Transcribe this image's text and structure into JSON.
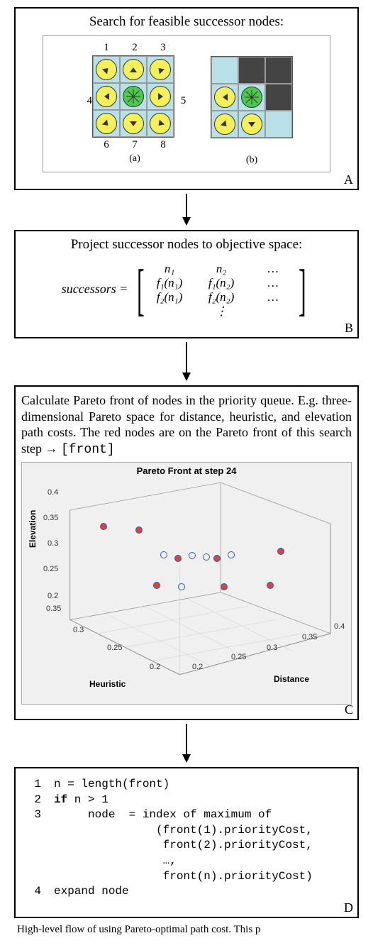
{
  "boxA": {
    "title": "Search for feasible successor nodes:",
    "label": "A",
    "gridA": {
      "top_labels": [
        "1",
        "2",
        "3"
      ],
      "left_label": "4",
      "right_label": "5",
      "bottom_labels": [
        "6",
        "7",
        "8"
      ],
      "sub": "(a)"
    },
    "gridB": {
      "sub": "(b)"
    }
  },
  "boxB": {
    "title": "Project successor nodes to objective space:",
    "label": "B",
    "lhs": "successors =",
    "row1": [
      "n₁",
      "n₂",
      "…"
    ],
    "row2": [
      "f₁(n₁)",
      "f₁(n₂)",
      "…"
    ],
    "row3": [
      "f₂(n₁)",
      "f₂(n₂)",
      "…"
    ],
    "row4_center": "⋮"
  },
  "boxC": {
    "text": "Calculate Pareto front of nodes in the priority queue. E.g. three-dimensional Pareto space for distance, heuristic, and elevation path costs. The red nodes are on the Pareto front of this search step → ",
    "code_word": "[front]",
    "label": "C",
    "chart_data": {
      "type": "scatter3d",
      "title": "Pareto Front at step 24",
      "xlabel": "Heuristic",
      "ylabel": "Distance",
      "zlabel": "Elevation",
      "x_ticks": [
        "0.2",
        "0.25",
        "0.3",
        "0.35"
      ],
      "y_ticks": [
        "0.2",
        "0.25",
        "0.3",
        "0.35",
        "0.4"
      ],
      "z_ticks": [
        "0.2",
        "0.25",
        "0.3",
        "0.35",
        "0.4"
      ],
      "points": [
        {
          "h": 0.21,
          "d": 0.29,
          "e": 0.36,
          "pareto": true
        },
        {
          "h": 0.23,
          "d": 0.24,
          "e": 0.35,
          "pareto": true
        },
        {
          "h": 0.24,
          "d": 0.22,
          "e": 0.3,
          "pareto": false
        },
        {
          "h": 0.26,
          "d": 0.26,
          "e": 0.29,
          "pareto": true
        },
        {
          "h": 0.27,
          "d": 0.28,
          "e": 0.3,
          "pareto": false
        },
        {
          "h": 0.28,
          "d": 0.3,
          "e": 0.3,
          "pareto": false
        },
        {
          "h": 0.29,
          "d": 0.27,
          "e": 0.3,
          "pareto": true
        },
        {
          "h": 0.3,
          "d": 0.3,
          "e": 0.3,
          "pareto": false
        },
        {
          "h": 0.32,
          "d": 0.37,
          "e": 0.3,
          "pareto": true
        },
        {
          "h": 0.25,
          "d": 0.3,
          "e": 0.25,
          "pareto": true
        },
        {
          "h": 0.27,
          "d": 0.32,
          "e": 0.25,
          "pareto": false
        },
        {
          "h": 0.3,
          "d": 0.24,
          "e": 0.25,
          "pareto": true
        },
        {
          "h": 0.33,
          "d": 0.36,
          "e": 0.25,
          "pareto": true
        }
      ]
    }
  },
  "boxD": {
    "label": "D",
    "lines": [
      {
        "n": "1",
        "indent": 0,
        "text": "n = length(front)"
      },
      {
        "n": "2",
        "indent": 0,
        "text_parts": [
          {
            "kw": true,
            "t": "if"
          },
          {
            "kw": false,
            "t": " n > 1"
          }
        ]
      },
      {
        "n": "3",
        "indent": 1,
        "text": "node  = index of maximum of"
      },
      {
        "n": "",
        "indent": 3,
        "text": "(front(1).priorityCost,"
      },
      {
        "n": "",
        "indent": 3,
        "text": " front(2).priorityCost,"
      },
      {
        "n": "",
        "indent": 3,
        "text": " …,"
      },
      {
        "n": "",
        "indent": 3,
        "text": " front(n).priorityCost)"
      },
      {
        "n": "4",
        "indent": 0,
        "text": "expand node"
      }
    ]
  },
  "caption": "High-level flow of using Pareto-optimal path cost. This p"
}
